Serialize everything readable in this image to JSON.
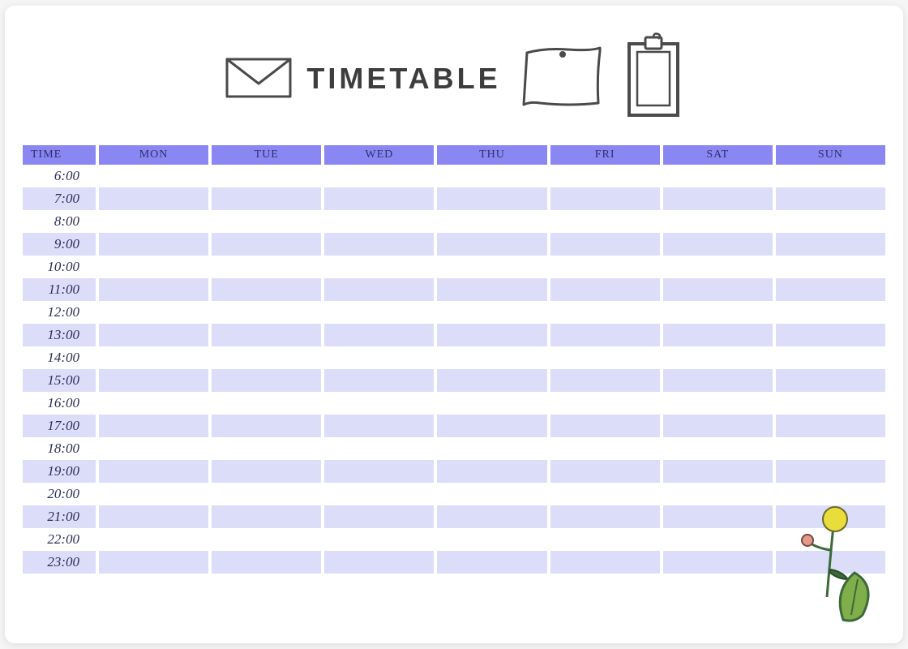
{
  "title": "TIMETABLE",
  "headers": {
    "time": "TIME",
    "days": [
      "MON",
      "TUE",
      "WED",
      "THU",
      "FRI",
      "SAT",
      "SUN"
    ]
  },
  "rows": [
    {
      "time": "6:00",
      "cells": [
        "",
        "",
        "",
        "",
        "",
        "",
        ""
      ]
    },
    {
      "time": "7:00",
      "cells": [
        "",
        "",
        "",
        "",
        "",
        "",
        ""
      ]
    },
    {
      "time": "8:00",
      "cells": [
        "",
        "",
        "",
        "",
        "",
        "",
        ""
      ]
    },
    {
      "time": "9:00",
      "cells": [
        "",
        "",
        "",
        "",
        "",
        "",
        ""
      ]
    },
    {
      "time": "10:00",
      "cells": [
        "",
        "",
        "",
        "",
        "",
        "",
        ""
      ]
    },
    {
      "time": "11:00",
      "cells": [
        "",
        "",
        "",
        "",
        "",
        "",
        ""
      ]
    },
    {
      "time": "12:00",
      "cells": [
        "",
        "",
        "",
        "",
        "",
        "",
        ""
      ]
    },
    {
      "time": "13:00",
      "cells": [
        "",
        "",
        "",
        "",
        "",
        "",
        ""
      ]
    },
    {
      "time": "14:00",
      "cells": [
        "",
        "",
        "",
        "",
        "",
        "",
        ""
      ]
    },
    {
      "time": "15:00",
      "cells": [
        "",
        "",
        "",
        "",
        "",
        "",
        ""
      ]
    },
    {
      "time": "16:00",
      "cells": [
        "",
        "",
        "",
        "",
        "",
        "",
        ""
      ]
    },
    {
      "time": "17:00",
      "cells": [
        "",
        "",
        "",
        "",
        "",
        "",
        ""
      ]
    },
    {
      "time": "18:00",
      "cells": [
        "",
        "",
        "",
        "",
        "",
        "",
        ""
      ]
    },
    {
      "time": "19:00",
      "cells": [
        "",
        "",
        "",
        "",
        "",
        "",
        ""
      ]
    },
    {
      "time": "20:00",
      "cells": [
        "",
        "",
        "",
        "",
        "",
        "",
        ""
      ]
    },
    {
      "time": "21:00",
      "cells": [
        "",
        "",
        "",
        "",
        "",
        "",
        ""
      ]
    },
    {
      "time": "22:00",
      "cells": [
        "",
        "",
        "",
        "",
        "",
        "",
        ""
      ]
    },
    {
      "time": "23:00",
      "cells": [
        "",
        "",
        "",
        "",
        "",
        "",
        ""
      ]
    }
  ],
  "colors": {
    "header_bg": "#8a87f2",
    "stripe": "#dcddf9"
  }
}
